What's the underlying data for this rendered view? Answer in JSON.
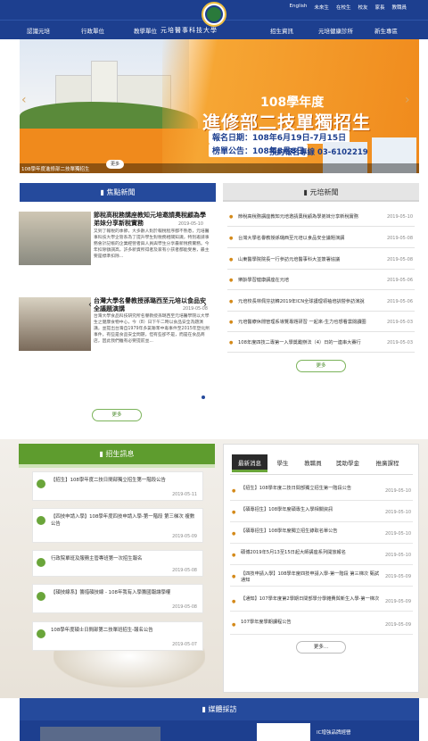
{
  "top_links": [
    "English",
    "未來生",
    "在校生",
    "校友",
    "家長",
    "教職員"
  ],
  "nav": {
    "left": [
      "認識元培",
      "行政單位",
      "教學單位"
    ],
    "right": [
      "招生資訊",
      "元培健康診所",
      "新生專區"
    ],
    "school_name": "元培醫事科技大學"
  },
  "banner": {
    "subtitle": "108學年度",
    "title": "進修部二技單獨招生",
    "line1": "報名日期：108年6月19日-7月15日",
    "line2": "榜單公告：108年8月8日",
    "phone": "預約報名專線 03-6102219",
    "caption": "108學年度進修部二技單獨招生",
    "more": "更多"
  },
  "headers": {
    "focus": "焦點新聞",
    "campus": "元培新聞",
    "recruit": "招生訊息",
    "media": "媒體採訪"
  },
  "focus_news": [
    {
      "title": "節稅高稅務講座教知元培邀請奧稅顧為學弟妹分享新稅實務",
      "date": "2019-05-10",
      "body": "又到了報稅的季節，大多數人對於報稅程序都不熟悉，元培醫事科技大學企管系為了提升學生對稅務相關知識，特別邀請事務會計記帳的企業經營者與人員與學生分享最新稅務實務。今年扣除額調高，許多新資所得者及家有小孩者都能受惠，最主要是標準扣除..."
    },
    {
      "title": "台灣大學名譽教授孫璐西至元培以食品安全議題演講",
      "date": "2019-05-08",
      "body": "台灣大學食品科技研究所名譽教授孫璐西至元培醫學院以大學生之健康食物中心，今（8）日下午二時以食品安全為題演講，並提出台灣自1979年多氯聯苯中毒事件至2015年塑化劑事件，有些是食品安全問題，但有些卻不是，而是在食品商店，因此我們雖有必要提前並..."
    }
  ],
  "campus_news": [
    {
      "title": "節稅高稅務講座教知元培邀請奧稅顧為學弟妹分享新稅實務",
      "date": "2019-05-10"
    },
    {
      "title": "台灣大學名譽教授孫璐西至元培以食品安全議題演講",
      "date": "2019-05-08"
    },
    {
      "title": "山東醫學院院長一行參訪元培醫事科大並簽署協議",
      "date": "2019-05-08"
    },
    {
      "title": "樂齡學習健康講座在元培",
      "date": "2019-05-06"
    },
    {
      "title": "元培校長林佩芬訪韓2019年ICN全球護理領袖培訓營參訪演說",
      "date": "2019-05-06"
    },
    {
      "title": "元培醫療休閒管理系導覽專題研習 一起來-生力也想看雲閱讀圈",
      "date": "2019-05-03"
    },
    {
      "title": "108年度四技二專第一入學獎勵辦法（4）日的一連串大賽行",
      "date": "2019-05-03"
    }
  ],
  "more_label": "更多",
  "more_dots": "更多...",
  "recruit": [
    {
      "title": "【招生】108學年度二技日間部獨立招生第一階段公告",
      "date": "2019-05-11"
    },
    {
      "title": "【四技申請入學】108學年度四技申請入學-第一階段 第三梯次 複數公告",
      "date": "2019-05-09"
    },
    {
      "title": "行政院單班及服務主管專班第一次招生報名",
      "date": "2019-05-08"
    },
    {
      "title": "【碩技線系】籌措碩技線 - 108年我有入學籌國報讓學權",
      "date": "2019-05-08"
    },
    {
      "title": "108學年度碩士日間部第二技單班招生-報名公告",
      "date": "2019-05-07"
    }
  ],
  "tabs": [
    "最新消息",
    "學生",
    "教職員",
    "獎助學金",
    "推廣課程"
  ],
  "panel_items": [
    {
      "title": "【招生】108學年度二技日間部獨立招生第一階段公告",
      "date": "2019-05-10"
    },
    {
      "title": "【碩專招生】108學年度碩專生入學相關資訊",
      "date": "2019-05-10"
    },
    {
      "title": "【碩專招生】108學年度獨立招生錄取名單公告",
      "date": "2019-05-10"
    },
    {
      "title": "碩博2019年5月13至15日起大師講座系列開放報名",
      "date": "2019-05-10"
    },
    {
      "title": "【四技申請入學】108學年度四技申請入學-第一階段 第三梯次 甄試通知",
      "date": "2019-05-09"
    },
    {
      "title": "【通知】107學年度第2學期日間部學分學雜費與新生入學-第一梯次",
      "date": "2019-05-09"
    },
    {
      "title": "107學年度學期課程公告",
      "date": "2019-05-09"
    }
  ],
  "media_label": "IC增強品牌經營"
}
